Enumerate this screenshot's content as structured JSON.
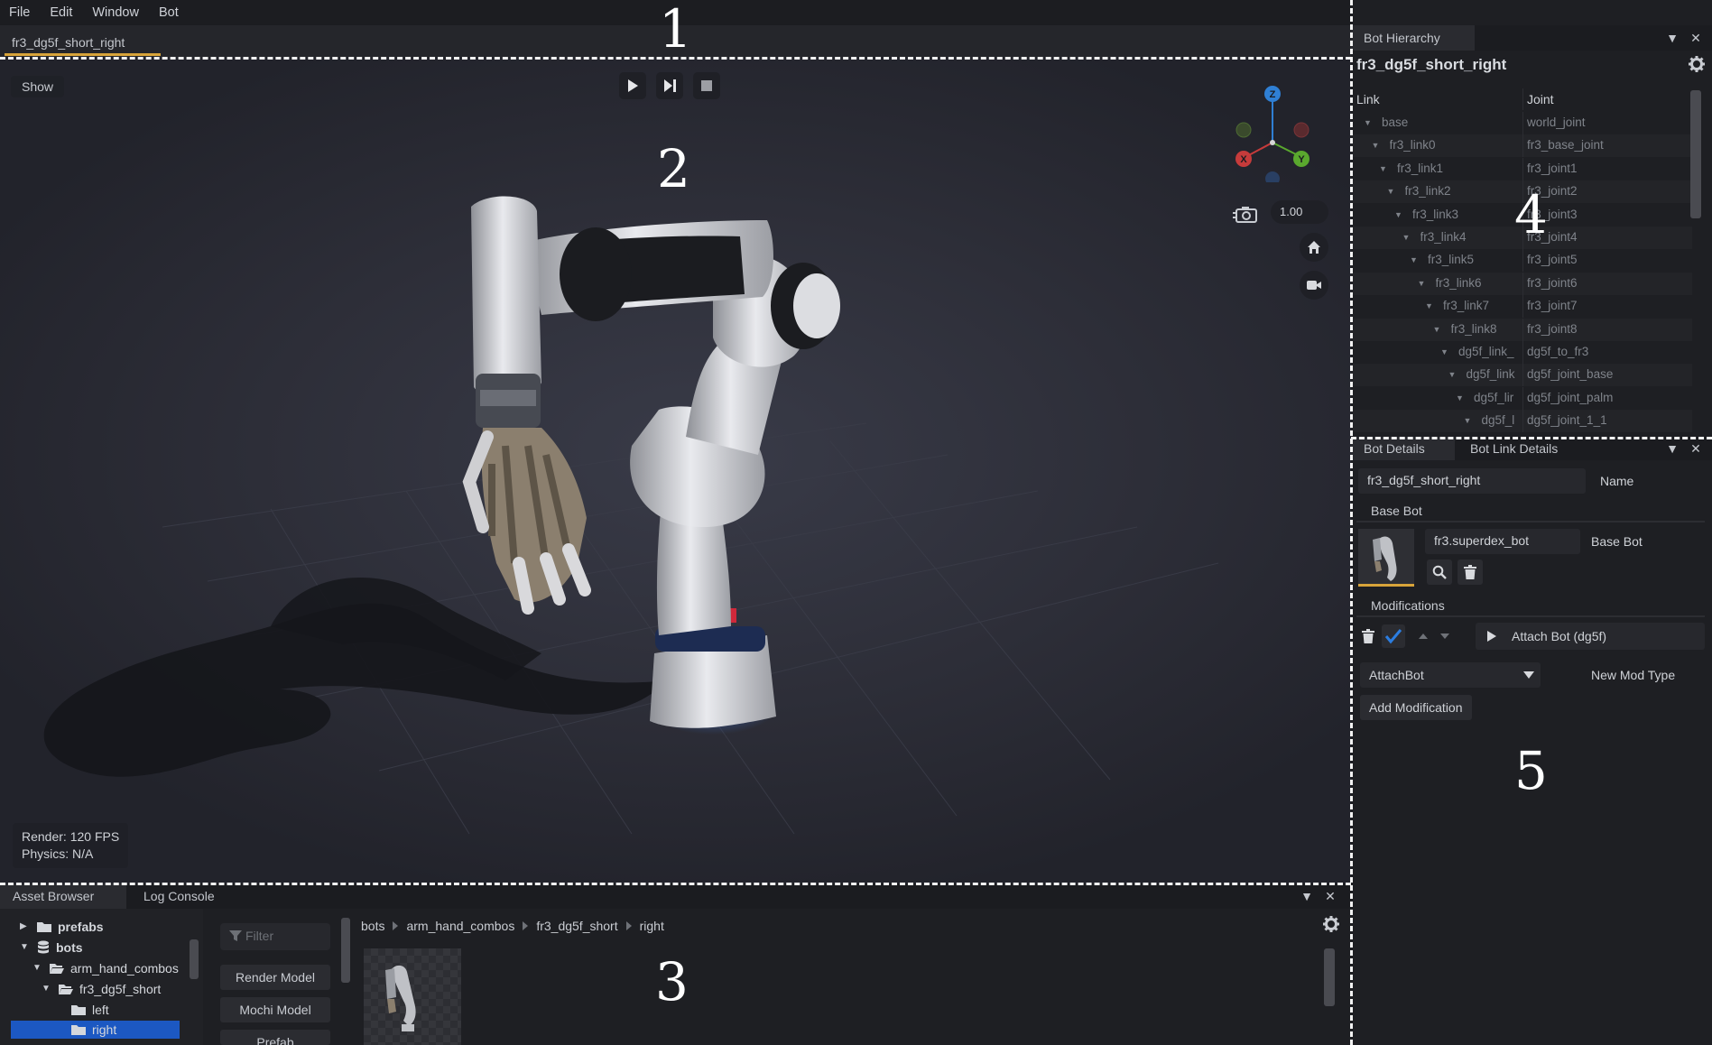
{
  "menu": [
    "File",
    "Edit",
    "Window",
    "Bot"
  ],
  "document_tab": "fr3_dg5f_short_right",
  "viewport": {
    "show_button": "Show",
    "speed_value": "1.00",
    "gizmo_axes": {
      "z": "Z",
      "x": "X",
      "y": "Y"
    },
    "stats": {
      "render": "Render:  120 FPS",
      "physics": "Physics: N/A"
    }
  },
  "asset_browser": {
    "tabs": [
      "Asset Browser",
      "Log Console"
    ],
    "tree": [
      {
        "label": "prefabs",
        "bold": true
      },
      {
        "label": "bots",
        "bold": true
      },
      {
        "label": "arm_hand_combos",
        "bold": false
      },
      {
        "label": "fr3_dg5f_short",
        "bold": false
      },
      {
        "label": "left",
        "bold": false
      },
      {
        "label": "right",
        "bold": false
      }
    ],
    "filter_placeholder": "Filter",
    "filter_buttons": [
      "Render Model",
      "Mochi Model",
      "Prefab"
    ],
    "breadcrumb": [
      "bots",
      "arm_hand_combos",
      "fr3_dg5f_short",
      "right"
    ]
  },
  "bot_hierarchy": {
    "tab": "Bot Hierarchy",
    "title": "fr3_dg5f_short_right",
    "columns": [
      "Link",
      "Joint"
    ],
    "rows": [
      {
        "link": "base",
        "joint": "world_joint"
      },
      {
        "link": "fr3_link0",
        "joint": "fr3_base_joint"
      },
      {
        "link": "fr3_link1",
        "joint": "fr3_joint1"
      },
      {
        "link": "fr3_link2",
        "joint": "fr3_joint2"
      },
      {
        "link": "fr3_link3",
        "joint": "fr3_joint3"
      },
      {
        "link": "fr3_link4",
        "joint": "fr3_joint4"
      },
      {
        "link": "fr3_link5",
        "joint": "fr3_joint5"
      },
      {
        "link": "fr3_link6",
        "joint": "fr3_joint6"
      },
      {
        "link": "fr3_link7",
        "joint": "fr3_joint7"
      },
      {
        "link": "fr3_link8",
        "joint": "fr3_joint8"
      },
      {
        "link": "dg5f_link_",
        "joint": "dg5f_to_fr3"
      },
      {
        "link": "dg5f_link",
        "joint": "dg5f_joint_base"
      },
      {
        "link": "dg5f_lir",
        "joint": "dg5f_joint_palm"
      },
      {
        "link": "dg5f_l",
        "joint": "dg5f_joint_1_1"
      }
    ]
  },
  "bot_details": {
    "tabs": [
      "Bot Details",
      "Bot Link Details"
    ],
    "name_value": "fr3_dg5f_short_right",
    "name_label": "Name",
    "base_bot_section": "Base Bot",
    "base_bot_value": "fr3.superdex_bot",
    "base_bot_label": "Base Bot",
    "modifications_section": "Modifications",
    "modification_item": "Attach Bot (dg5f)",
    "new_mod_type_value": "AttachBot",
    "new_mod_type_label": "New Mod Type",
    "add_modification": "Add Modification"
  },
  "region_labels": [
    "1",
    "2",
    "3",
    "4",
    "5"
  ]
}
